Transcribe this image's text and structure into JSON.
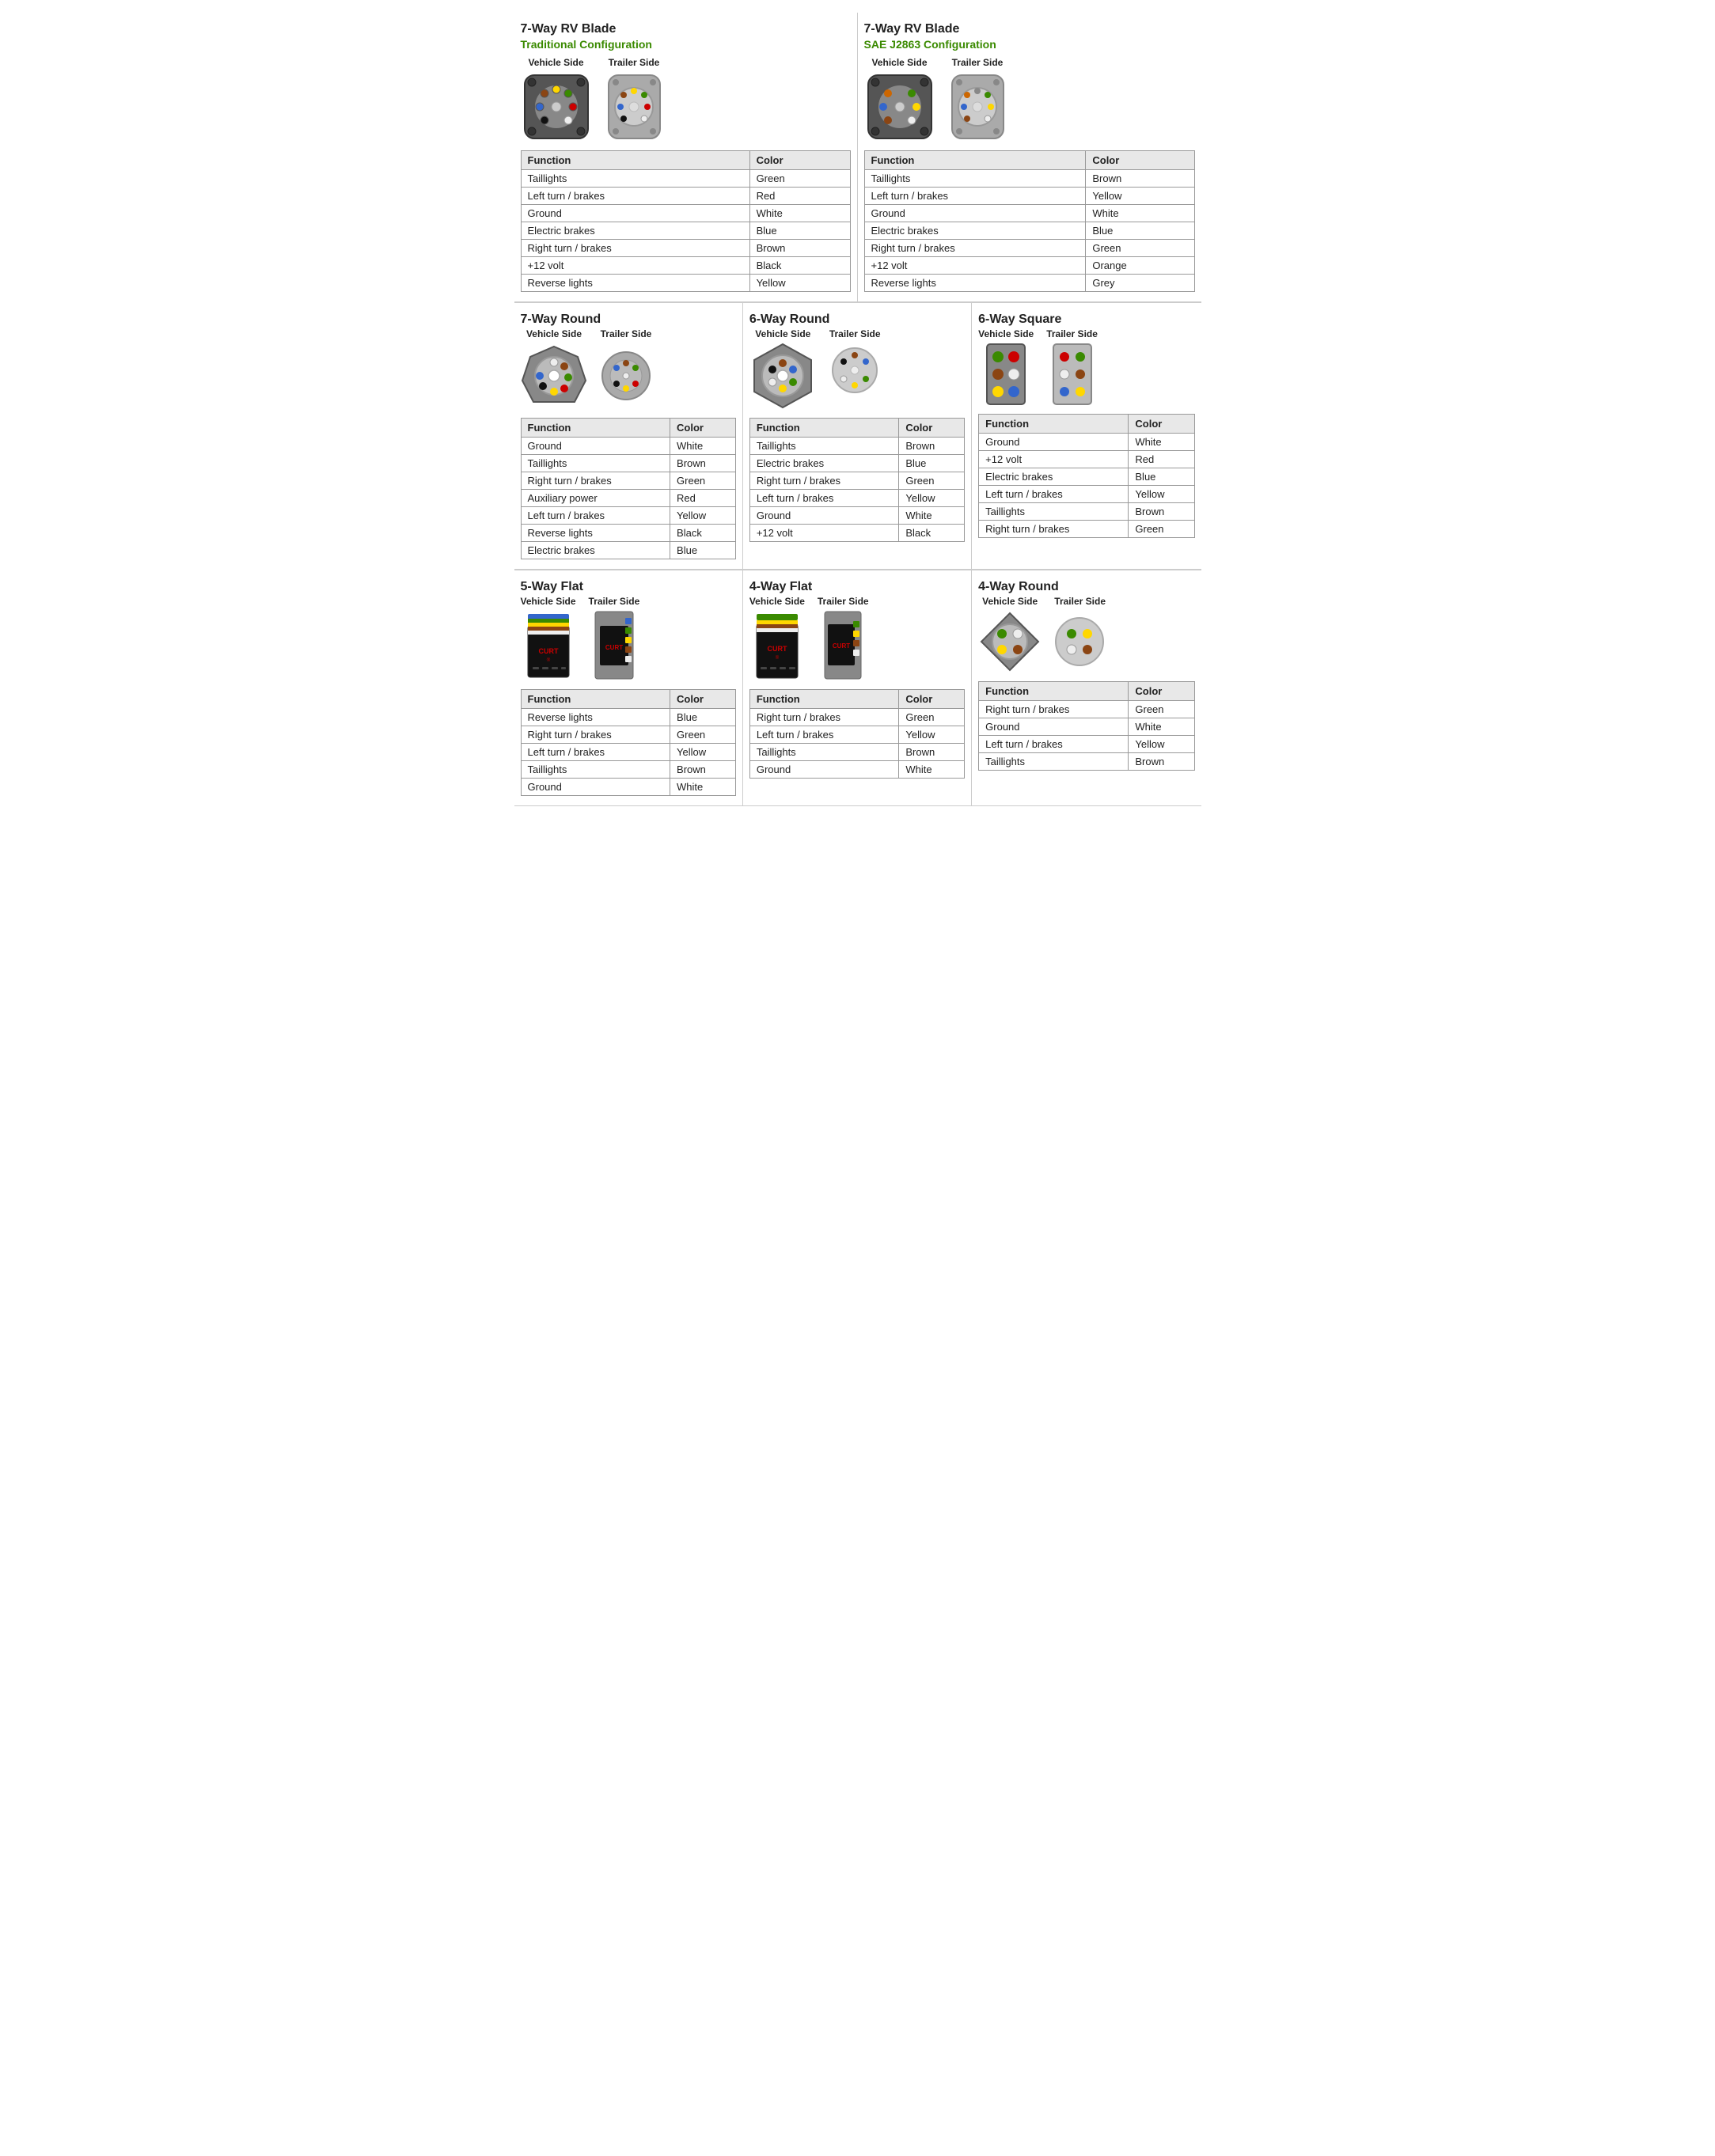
{
  "sections": {
    "rv_blade_traditional": {
      "title": "7-Way RV Blade",
      "subtitle": "Traditional Configuration",
      "subtitle_color": "green",
      "vehicle_label": "Vehicle Side",
      "trailer_label": "Trailer Side",
      "table": {
        "headers": [
          "Function",
          "Color"
        ],
        "rows": [
          [
            "Taillights",
            "Green"
          ],
          [
            "Left turn / brakes",
            "Red"
          ],
          [
            "Ground",
            "White"
          ],
          [
            "Electric brakes",
            "Blue"
          ],
          [
            "Right turn / brakes",
            "Brown"
          ],
          [
            "+12 volt",
            "Black"
          ],
          [
            "Reverse lights",
            "Yellow"
          ]
        ]
      }
    },
    "rv_blade_sae": {
      "title": "7-Way RV Blade",
      "subtitle": "SAE J2863 Configuration",
      "subtitle_color": "green",
      "vehicle_label": "Vehicle Side",
      "trailer_label": "Trailer Side",
      "table": {
        "headers": [
          "Function",
          "Color"
        ],
        "rows": [
          [
            "Taillights",
            "Brown"
          ],
          [
            "Left turn / brakes",
            "Yellow"
          ],
          [
            "Ground",
            "White"
          ],
          [
            "Electric brakes",
            "Blue"
          ],
          [
            "Right turn / brakes",
            "Green"
          ],
          [
            "+12 volt",
            "Orange"
          ],
          [
            "Reverse lights",
            "Grey"
          ]
        ]
      }
    },
    "round_7way": {
      "title": "7-Way Round",
      "vehicle_label": "Vehicle Side",
      "trailer_label": "Trailer Side",
      "table": {
        "headers": [
          "Function",
          "Color"
        ],
        "rows": [
          [
            "Ground",
            "White"
          ],
          [
            "Taillights",
            "Brown"
          ],
          [
            "Right turn / brakes",
            "Green"
          ],
          [
            "Auxiliary power",
            "Red"
          ],
          [
            "Left turn / brakes",
            "Yellow"
          ],
          [
            "Reverse lights",
            "Black"
          ],
          [
            "Electric brakes",
            "Blue"
          ]
        ]
      }
    },
    "round_6way": {
      "title": "6-Way Round",
      "vehicle_label": "Vehicle Side",
      "trailer_label": "Trailer Side",
      "table": {
        "headers": [
          "Function",
          "Color"
        ],
        "rows": [
          [
            "Taillights",
            "Brown"
          ],
          [
            "Electric brakes",
            "Blue"
          ],
          [
            "Right turn / brakes",
            "Green"
          ],
          [
            "Left turn / brakes",
            "Yellow"
          ],
          [
            "Ground",
            "White"
          ],
          [
            "+12 volt",
            "Black"
          ]
        ]
      }
    },
    "square_6way": {
      "title": "6-Way Square",
      "vehicle_label": "Vehicle Side",
      "trailer_label": "Trailer Side",
      "table": {
        "headers": [
          "Function",
          "Color"
        ],
        "rows": [
          [
            "Ground",
            "White"
          ],
          [
            "+12 volt",
            "Red"
          ],
          [
            "Electric brakes",
            "Blue"
          ],
          [
            "Left turn / brakes",
            "Yellow"
          ],
          [
            "Taillights",
            "Brown"
          ],
          [
            "Right turn / brakes",
            "Green"
          ]
        ]
      }
    },
    "flat_5way": {
      "title": "5-Way Flat",
      "vehicle_label": "Vehicle Side",
      "trailer_label": "Trailer Side",
      "table": {
        "headers": [
          "Function",
          "Color"
        ],
        "rows": [
          [
            "Reverse lights",
            "Blue"
          ],
          [
            "Right turn / brakes",
            "Green"
          ],
          [
            "Left turn / brakes",
            "Yellow"
          ],
          [
            "Taillights",
            "Brown"
          ],
          [
            "Ground",
            "White"
          ]
        ]
      }
    },
    "flat_4way": {
      "title": "4-Way Flat",
      "vehicle_label": "Vehicle Side",
      "trailer_label": "Trailer Side",
      "table": {
        "headers": [
          "Function",
          "Color"
        ],
        "rows": [
          [
            "Right turn / brakes",
            "Green"
          ],
          [
            "Left turn / brakes",
            "Yellow"
          ],
          [
            "Taillights",
            "Brown"
          ],
          [
            "Ground",
            "White"
          ]
        ]
      }
    },
    "round_4way": {
      "title": "4-Way Round",
      "vehicle_label": "Vehicle Side",
      "trailer_label": "Trailer Side",
      "table": {
        "headers": [
          "Function",
          "Color"
        ],
        "rows": [
          [
            "Right turn / brakes",
            "Green"
          ],
          [
            "Ground",
            "White"
          ],
          [
            "Left turn / brakes",
            "Yellow"
          ],
          [
            "Taillights",
            "Brown"
          ]
        ]
      }
    }
  }
}
